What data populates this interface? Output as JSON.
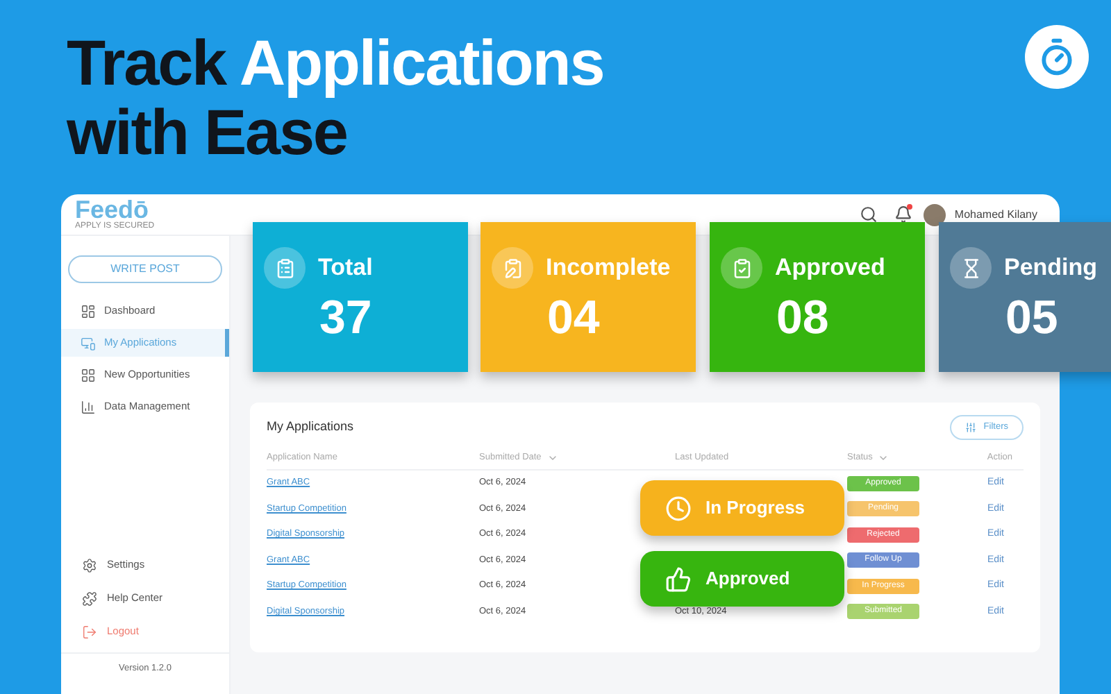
{
  "headline": {
    "line1_dark": "Track",
    "line1_light": "Applications",
    "line2": "with Ease"
  },
  "app": {
    "logo": "Feedō",
    "logo_tagline": "APPLY IS SECURED",
    "user_name": "Mohamed Kilany",
    "notification_dot": true,
    "sidebar": {
      "write_post": "WRITE POST",
      "items": [
        {
          "label": "Dashboard",
          "selected": false
        },
        {
          "label": "My Applications",
          "selected": true
        },
        {
          "label": "New Opportunities",
          "selected": false
        },
        {
          "label": "Data Management",
          "selected": false
        }
      ],
      "bottom_items": [
        {
          "label": "Settings",
          "kind": "normal"
        },
        {
          "label": "Help Center",
          "kind": "normal"
        },
        {
          "label": "Logout",
          "kind": "danger"
        }
      ],
      "version": "Version 1.2.0"
    },
    "table": {
      "title": "My Applications",
      "filters": "Filters",
      "columns": [
        {
          "label": "Application Name",
          "sortable": false
        },
        {
          "label": "Submitted Date",
          "sortable": true
        },
        {
          "label": "Last Updated",
          "sortable": false
        },
        {
          "label": "Status",
          "sortable": true
        },
        {
          "label": "Action",
          "sortable": false
        }
      ],
      "rows": [
        {
          "name": "Grant ABC",
          "submitted": "Oct 6, 2024",
          "status": "Approved",
          "color": "#6cc24a",
          "action": "Edit"
        },
        {
          "name": "Startup Competition",
          "submitted": "Oct 6, 2024",
          "status": "Pending",
          "color": "#f6c46c",
          "action": "Edit"
        },
        {
          "name": "Digital Sponsorship",
          "submitted": "Oct 6, 2024",
          "status": "Rejected",
          "color": "#ee6b6e",
          "action": "Edit"
        },
        {
          "name": "Grant ABC",
          "submitted": "Oct 6, 2024",
          "status": "Follow Up",
          "color": "#6f8fd3",
          "action": "Edit"
        },
        {
          "name": "Startup Competition",
          "submitted": "Oct 6, 2024",
          "status": "In Progress",
          "color": "#f7b94c",
          "action": "Edit"
        },
        {
          "name": "Digital Sponsorship",
          "submitted": "Oct 6, 2024",
          "updated": "Oct 10, 2024",
          "status": "Submitted",
          "color": "#a9d36f",
          "action": "Edit"
        }
      ]
    }
  },
  "stat_cards": [
    {
      "label": "Total",
      "value": "37",
      "color": "#0eafd5"
    },
    {
      "label": "Incomplete",
      "value": "04",
      "color": "#f7b51f"
    },
    {
      "label": "Approved",
      "value": "08",
      "color": "#36b50f"
    },
    {
      "label": "Pending",
      "value": "05",
      "color": "#507a96"
    }
  ],
  "floating_badges": [
    {
      "label": "In Progress",
      "color": "#f6b21d"
    },
    {
      "label": "Approved",
      "color": "#37b50f"
    }
  ]
}
